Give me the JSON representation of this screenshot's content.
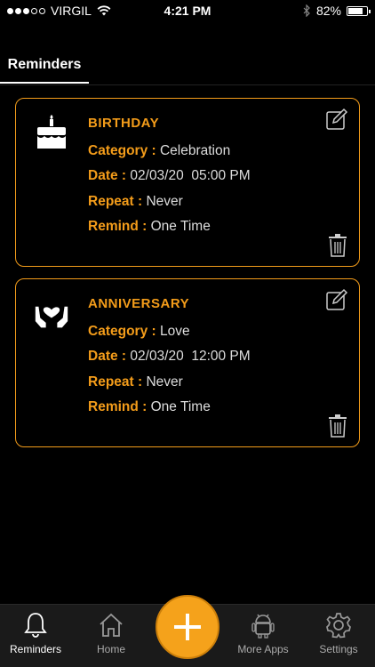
{
  "status": {
    "carrier": "VIRGIL",
    "time": "4:21 PM",
    "battery": "82%",
    "battery_level": 0.82
  },
  "tabs": [
    {
      "label": "Reminders"
    }
  ],
  "reminders": [
    {
      "title": "BIRTHDAY",
      "icon": "cake-icon",
      "category_label": "Category :",
      "category": "Celebration",
      "date_label": "Date :",
      "date": "02/03/20  05:00 PM",
      "repeat_label": "Repeat :",
      "repeat": "Never",
      "remind_label": "Remind :",
      "remind": "One Time"
    },
    {
      "title": "ANNIVERSARY",
      "icon": "heart-hands-icon",
      "category_label": "Category :",
      "category": "Love",
      "date_label": "Date :",
      "date": "02/03/20  12:00 PM",
      "repeat_label": "Repeat :",
      "repeat": "Never",
      "remind_label": "Remind :",
      "remind": "One Time"
    }
  ],
  "bottom_nav": [
    {
      "label": "Reminders",
      "icon": "bell-icon"
    },
    {
      "label": "Home",
      "icon": "home-icon"
    },
    {
      "label": "More Apps",
      "icon": "android-icon"
    },
    {
      "label": "Settings",
      "icon": "gear-icon"
    }
  ],
  "colors": {
    "accent": "#f39c1a",
    "background": "#000000",
    "nav_bg": "#1a1a1a"
  }
}
